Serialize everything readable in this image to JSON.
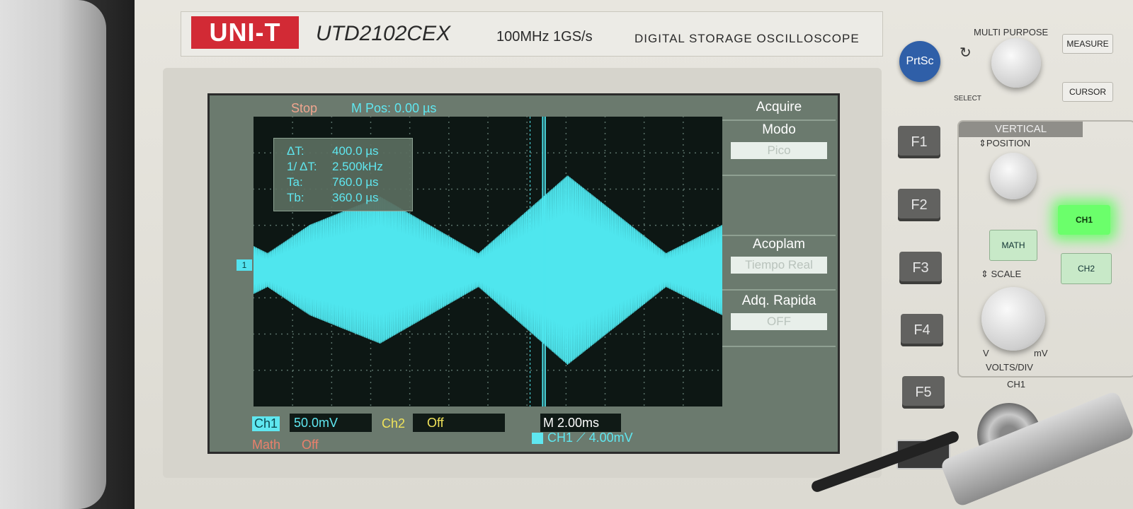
{
  "device": {
    "brand": "UNI-T",
    "model": "UTD2102CEX",
    "spec": "100MHz  1GS/s",
    "title": "DIGITAL STORAGE OSCILLOSCOPE"
  },
  "screen": {
    "status": "Stop",
    "m_pos": "M Pos: 0.00 µs",
    "trigger_marker": "1",
    "cursor": {
      "rows": [
        {
          "key": "ΔT:",
          "value": "400.0 µs"
        },
        {
          "key": "1/ ΔT:",
          "value": "2.500kHz"
        },
        {
          "key": "Ta:",
          "value": "760.0 µs"
        },
        {
          "key": "Tb:",
          "value": "360.0 µs"
        }
      ]
    },
    "menu": {
      "title": "Acquire",
      "items": [
        {
          "label": "Modo",
          "value": "Pico"
        },
        {
          "label": "Acoplam",
          "value": "Tiempo Real"
        },
        {
          "label": "Adq. Rapida",
          "value": "OFF"
        }
      ]
    },
    "bottom": {
      "ch1_tag": "Ch1",
      "ch1_scale": "50.0mV",
      "ch2_tag": "Ch2",
      "ch2_state": "Off",
      "timebase": "M 2.00ms",
      "math_tag": "Math",
      "math_state": "Off",
      "trigger": "CH1  ⟋  4.00mV"
    },
    "colors": {
      "trace": "#4fe6ee",
      "screen_bg": "#6b7a6e",
      "grid_bg": "#0d1714"
    }
  },
  "panel": {
    "prtsc": "PrtSc",
    "multi_purpose": "MULTI PURPOSE",
    "select": "SELECT",
    "measure": "MEASURE",
    "cursor": "CURSOR",
    "fkeys": [
      "F1",
      "F2",
      "F3",
      "F4",
      "F5"
    ],
    "vertical": "VERTICAL",
    "position": "⇕POSITION",
    "scale": "⇕ SCALE",
    "volts_div": "VOLTS/DIV",
    "v": "V",
    "mv": "mV",
    "math": "MATH",
    "ch1": "CH1",
    "ch2": "CH2",
    "ch1_input": "CH1"
  }
}
